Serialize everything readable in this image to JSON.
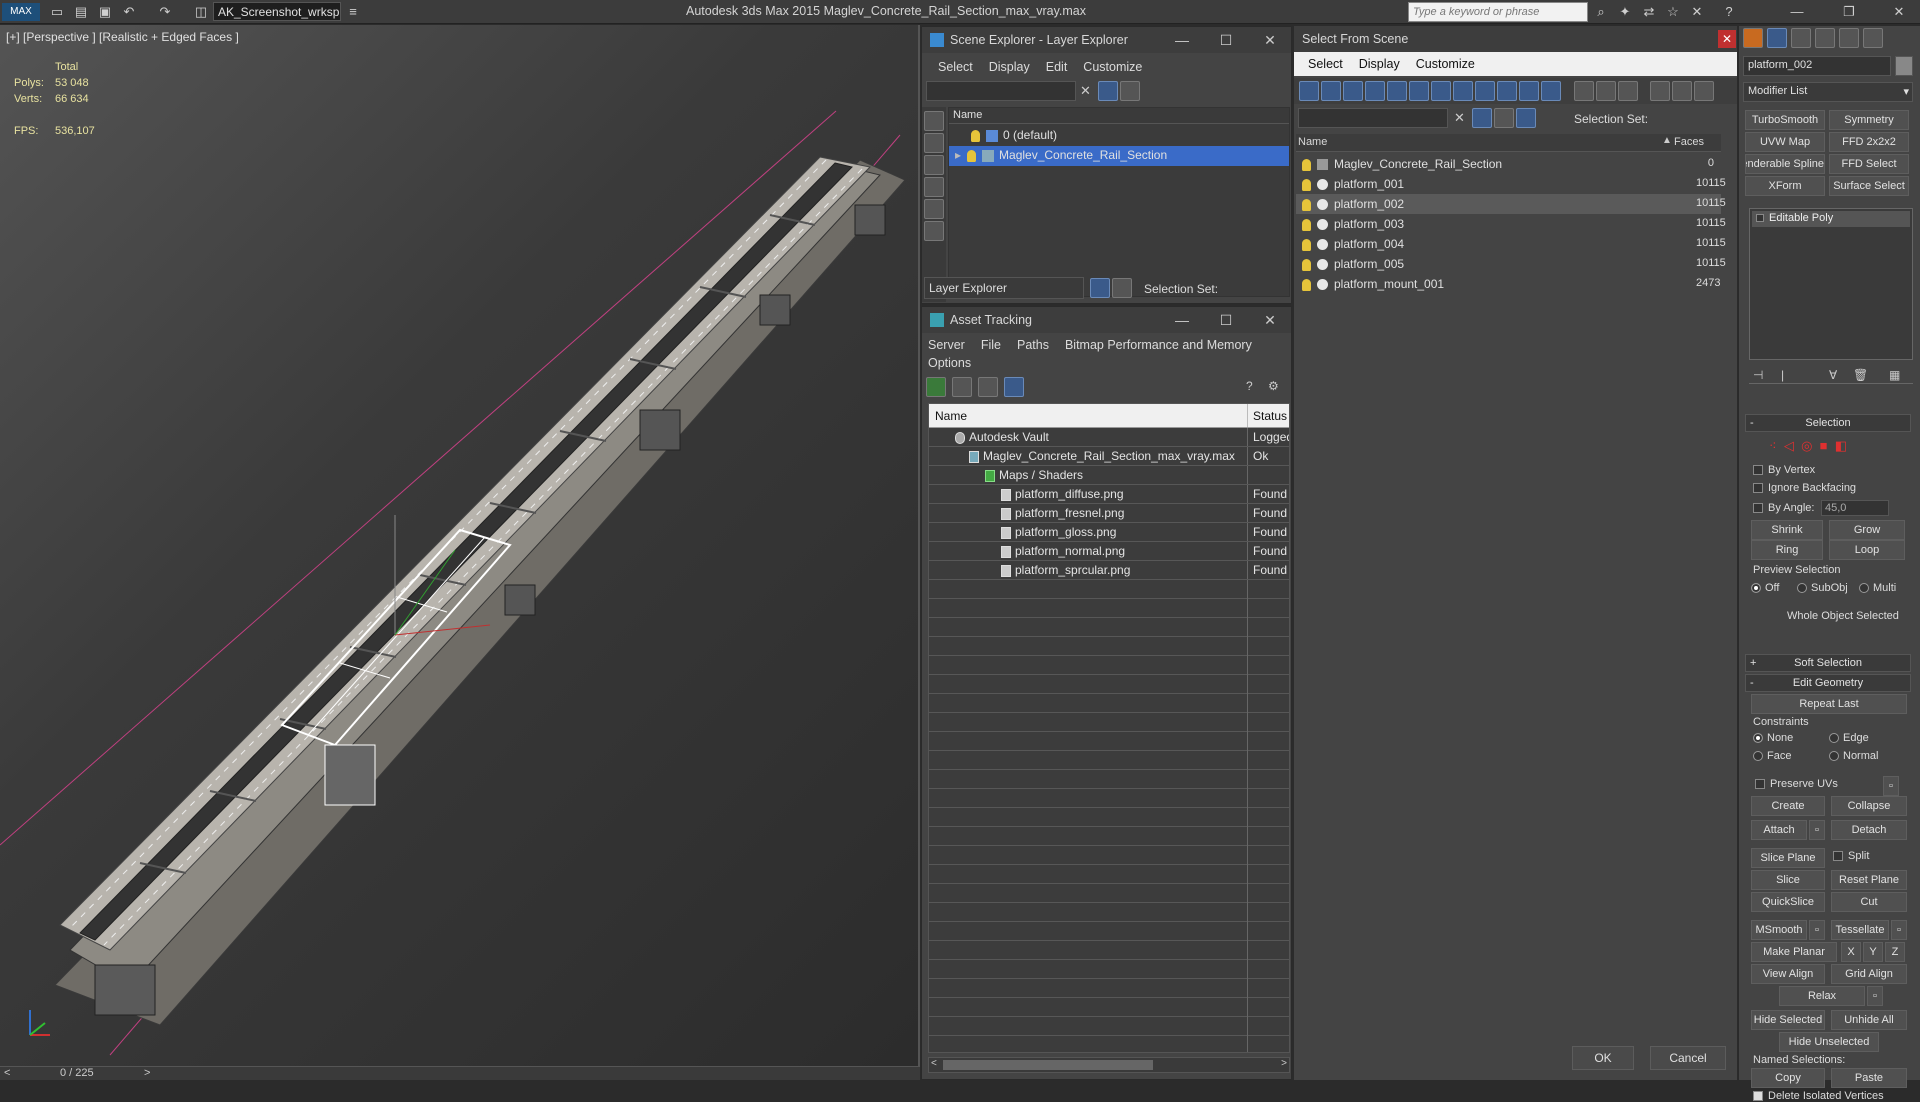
{
  "app": {
    "title": "Autodesk 3ds Max  2015    Maglev_Concrete_Rail_Section_max_vray.max",
    "workspace": "AK_Screenshot_wrksp",
    "search_placeholder": "Type a keyword or phrase"
  },
  "viewport": {
    "label": "[+] [Perspective ] [Realistic + Edged Faces ]",
    "stats": {
      "total_label": "Total",
      "polys_label": "Polys:",
      "polys": "53 048",
      "verts_label": "Verts:",
      "verts": "66 634",
      "fps_label": "FPS:",
      "fps": "536,107"
    },
    "timeline": "0 / 225"
  },
  "scene_explorer": {
    "title": "Scene Explorer - Layer Explorer",
    "menu": [
      "Select",
      "Display",
      "Edit",
      "Customize"
    ],
    "column": "Name",
    "layers": [
      "0 (default)",
      "Maglev_Concrete_Rail_Section"
    ],
    "footer_mode": "Layer Explorer",
    "selection_set": "Selection Set:"
  },
  "asset_tracking": {
    "title": "Asset Tracking",
    "menu": [
      "Server",
      "File",
      "Paths",
      "Bitmap Performance and Memory",
      "Options"
    ],
    "columns": [
      "Name",
      "Status"
    ],
    "rows": [
      {
        "name": "Autodesk Vault",
        "status": "Logged"
      },
      {
        "name": "Maglev_Concrete_Rail_Section_max_vray.max",
        "status": "Ok"
      },
      {
        "name": "Maps / Shaders",
        "status": ""
      },
      {
        "name": "platform_diffuse.png",
        "status": "Found"
      },
      {
        "name": "platform_fresnel.png",
        "status": "Found"
      },
      {
        "name": "platform_gloss.png",
        "status": "Found"
      },
      {
        "name": "platform_normal.png",
        "status": "Found"
      },
      {
        "name": "platform_sprcular.png",
        "status": "Found"
      }
    ]
  },
  "select_from_scene": {
    "title": "Select From Scene",
    "menu": [
      "Select",
      "Display",
      "Customize"
    ],
    "selection_set": "Selection Set:",
    "columns": [
      "Name",
      "Faces"
    ],
    "rows": [
      {
        "name": "Maglev_Concrete_Rail_Section",
        "faces": "0"
      },
      {
        "name": "platform_001",
        "faces": "10115"
      },
      {
        "name": "platform_002",
        "faces": "10115"
      },
      {
        "name": "platform_003",
        "faces": "10115"
      },
      {
        "name": "platform_004",
        "faces": "10115"
      },
      {
        "name": "platform_005",
        "faces": "10115"
      },
      {
        "name": "platform_mount_001",
        "faces": "2473"
      }
    ],
    "ok": "OK",
    "cancel": "Cancel"
  },
  "command_panel": {
    "object_name": "platform_002",
    "modifier_list": "Modifier List",
    "modifiers": [
      "TurboSmooth",
      "Symmetry",
      "UVW Map",
      "FFD 2x2x2",
      "Renderable Spline",
      "FFD Select",
      "XForm",
      "Surface Select"
    ],
    "stack_item": "Editable Poly",
    "selection": {
      "title": "Selection",
      "by_vertex": "By Vertex",
      "ignore_backfacing": "Ignore Backfacing",
      "by_angle": "By Angle:",
      "angle_value": "45,0",
      "shrink": "Shrink",
      "grow": "Grow",
      "ring": "Ring",
      "loop": "Loop",
      "preview_selection": "Preview Selection",
      "off": "Off",
      "subobj": "SubObj",
      "multi": "Multi",
      "status": "Whole Object Selected"
    },
    "soft_selection": "Soft Selection",
    "edit_geometry": {
      "title": "Edit Geometry",
      "repeat_last": "Repeat Last",
      "constraints": "Constraints",
      "none": "None",
      "edge": "Edge",
      "face": "Face",
      "normal": "Normal",
      "preserve_uvs": "Preserve UVs",
      "create": "Create",
      "collapse": "Collapse",
      "attach": "Attach",
      "detach": "Detach",
      "slice_plane": "Slice Plane",
      "split": "Split",
      "slice": "Slice",
      "reset_plane": "Reset Plane",
      "quickslice": "QuickSlice",
      "cut": "Cut",
      "msmooth": "MSmooth",
      "tessellate": "Tessellate",
      "make_planar": "Make Planar",
      "x": "X",
      "y": "Y",
      "z": "Z",
      "view_align": "View Align",
      "grid_align": "Grid Align",
      "relax": "Relax",
      "hide_selected": "Hide Selected",
      "unhide_all": "Unhide All",
      "hide_unselected": "Hide Unselected",
      "named_selections": "Named Selections:",
      "copy": "Copy",
      "paste": "Paste",
      "delete_isolated": "Delete Isolated Vertices"
    }
  }
}
